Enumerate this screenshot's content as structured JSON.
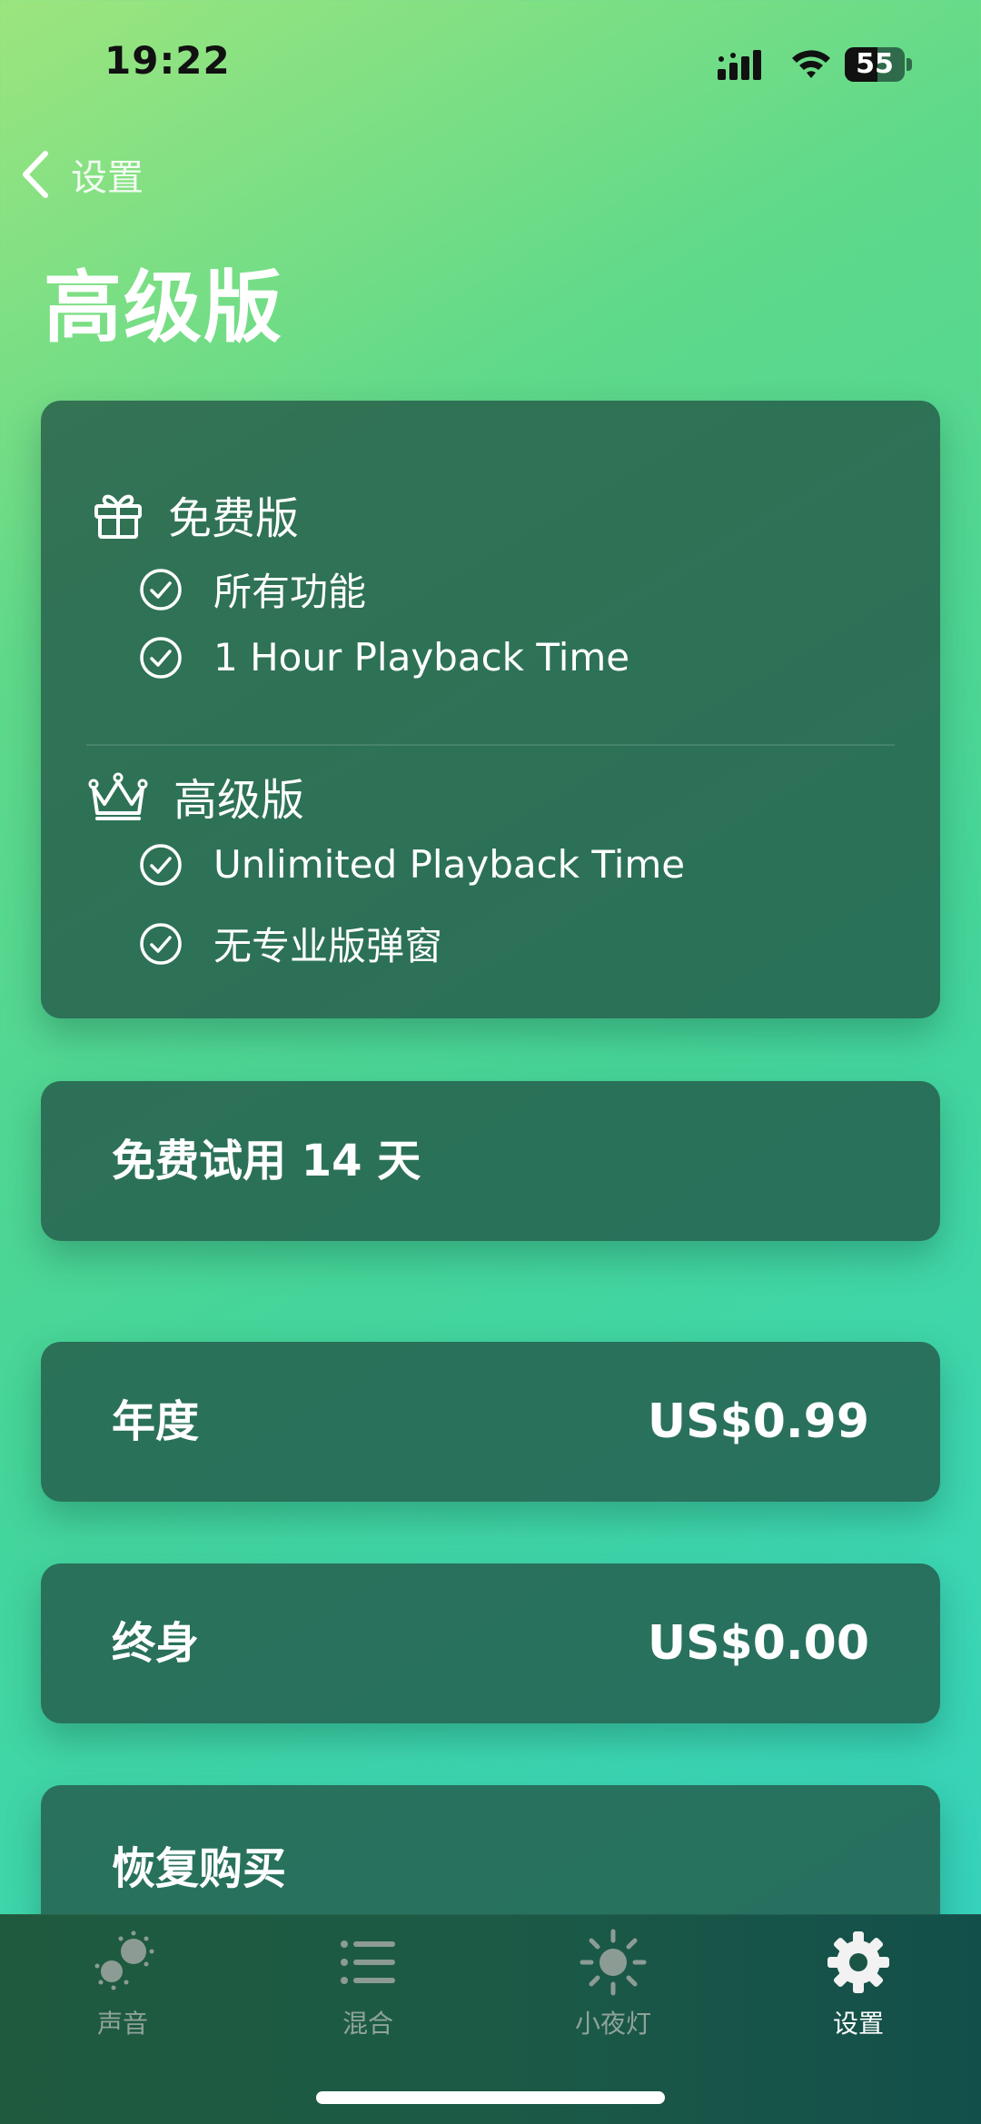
{
  "status_bar": {
    "time": "19:22",
    "battery": "55",
    "battery_level": 0.55
  },
  "nav": {
    "back_label": "设置"
  },
  "page": {
    "title": "高级版"
  },
  "features": {
    "free": {
      "title": "免费版",
      "icon": "gift-icon",
      "items": [
        "所有功能",
        "1 Hour Playback Time"
      ]
    },
    "premium": {
      "title": "高级版",
      "icon": "crown-icon",
      "items": [
        "Unlimited Playback Time",
        "无专业版弹窗"
      ]
    }
  },
  "trial": {
    "label": "免费试用 14 天"
  },
  "plans": [
    {
      "label": "年度",
      "price": "US$0.99"
    },
    {
      "label": "终身",
      "price": "US$0.00"
    }
  ],
  "restore": {
    "label": "恢复购买"
  },
  "tabs": [
    {
      "label": "声音",
      "icon": "sound-bubbles-icon",
      "active": false
    },
    {
      "label": "混合",
      "icon": "list-icon",
      "active": false
    },
    {
      "label": "小夜灯",
      "icon": "sun-icon",
      "active": false
    },
    {
      "label": "设置",
      "icon": "gear-icon",
      "active": true
    }
  ],
  "colors": {
    "accent_card": "#235546",
    "text": "#ffffff",
    "tab_inactive": "#8fa39a"
  }
}
